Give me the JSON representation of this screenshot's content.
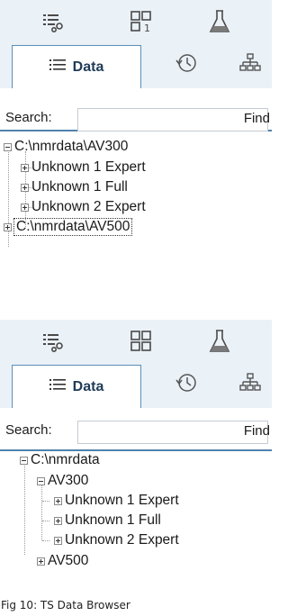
{
  "panels": [
    {
      "toolbar": {
        "icons": [
          "steps-icon",
          "layout-icon",
          "flask-icon"
        ]
      },
      "tabs": [
        {
          "label": "Data",
          "icon": "list-icon",
          "active": true
        },
        {
          "label": "",
          "icon": "history-icon",
          "active": false
        },
        {
          "label": "",
          "icon": "hierarchy-icon",
          "active": false
        }
      ],
      "search": {
        "label": "Search:",
        "value": "",
        "find_label": "Find"
      },
      "tree": [
        {
          "label": "C:\\nmrdata\\AV300",
          "expanded": true,
          "level": 0
        },
        {
          "label": "Unknown 1 Expert",
          "expanded": false,
          "level": 1
        },
        {
          "label": "Unknown 1 Full",
          "expanded": false,
          "level": 1
        },
        {
          "label": "Unknown 2 Expert",
          "expanded": false,
          "level": 1
        },
        {
          "label": "C:\\nmrdata\\AV500",
          "expanded": false,
          "level": 0,
          "focused": true
        }
      ]
    },
    {
      "toolbar": {
        "icons": [
          "steps-icon",
          "layout-icon",
          "flask-icon"
        ]
      },
      "tabs": [
        {
          "label": "Data",
          "icon": "list-icon",
          "active": true
        },
        {
          "label": "",
          "icon": "history-icon",
          "active": false
        },
        {
          "label": "",
          "icon": "hierarchy-icon",
          "active": false
        }
      ],
      "search": {
        "label": "Search:",
        "value": "",
        "find_label": "Find"
      },
      "tree": [
        {
          "label": "C:\\nmrdata",
          "expanded": true,
          "level": 0
        },
        {
          "label": "AV300",
          "expanded": true,
          "level": 1
        },
        {
          "label": "Unknown 1 Expert",
          "expanded": false,
          "level": 2
        },
        {
          "label": "Unknown 1 Full",
          "expanded": false,
          "level": 2
        },
        {
          "label": "Unknown 2 Expert",
          "expanded": false,
          "level": 2
        },
        {
          "label": "AV500",
          "expanded": false,
          "level": 1
        }
      ]
    }
  ],
  "caption": "Fig 10: TS Data Browser",
  "colors": {
    "toolbar_bg": "#eaf1f7",
    "tab_border": "#5b8fb9",
    "tab_text": "#1f3b57"
  }
}
